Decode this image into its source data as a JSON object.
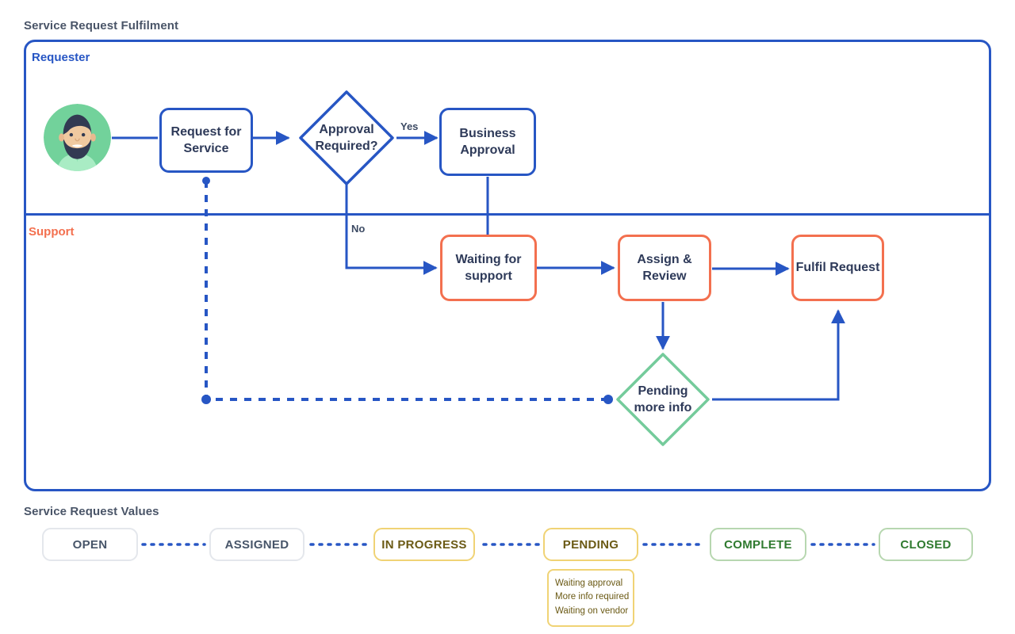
{
  "diagram": {
    "title": "Service Request Fulfilment",
    "lanes": [
      {
        "id": "requester",
        "label": "Requester",
        "color": "#2756c4"
      },
      {
        "id": "support",
        "label": "Support",
        "color": "#f3704f"
      }
    ],
    "nodes": [
      {
        "id": "avatar",
        "label": "",
        "shape": "avatar",
        "lane": "requester"
      },
      {
        "id": "request-for-service",
        "label": "Request for Service",
        "shape": "rounded-rect",
        "color": "#2756c4",
        "lane": "requester"
      },
      {
        "id": "approval-required",
        "label": "Approval Required?",
        "shape": "diamond",
        "color": "#2756c4",
        "lane": "requester"
      },
      {
        "id": "business-approval",
        "label": "Business Approval",
        "shape": "rounded-rect",
        "color": "#2756c4",
        "lane": "requester"
      },
      {
        "id": "waiting-for-support",
        "label": "Waiting for support",
        "shape": "rounded-rect",
        "color": "#f3704f",
        "lane": "support"
      },
      {
        "id": "assign-review",
        "label": "Assign & Review",
        "shape": "rounded-rect",
        "color": "#f3704f",
        "lane": "support"
      },
      {
        "id": "fulfil-request",
        "label": "Fulfil Request",
        "shape": "rounded-rect",
        "color": "#f3704f",
        "lane": "support"
      },
      {
        "id": "pending-more-info",
        "label": "Pending more info",
        "shape": "diamond",
        "color": "#74cb9b",
        "lane": "support"
      }
    ],
    "edge_labels": {
      "yes": "Yes",
      "no": "No"
    }
  },
  "values": {
    "title": "Service Request Values",
    "items": [
      {
        "id": "open",
        "label": "OPEN",
        "style": "grey"
      },
      {
        "id": "assigned",
        "label": "ASSIGNED",
        "style": "grey"
      },
      {
        "id": "in-progress",
        "label": "IN PROGRESS",
        "style": "yellow"
      },
      {
        "id": "pending",
        "label": "PENDING",
        "style": "yellow"
      },
      {
        "id": "complete",
        "label": "COMPLETE",
        "style": "green"
      },
      {
        "id": "closed",
        "label": "CLOSED",
        "style": "green"
      }
    ],
    "pending_reasons": [
      "Waiting approval",
      "More info required",
      "Waiting on vendor"
    ]
  }
}
